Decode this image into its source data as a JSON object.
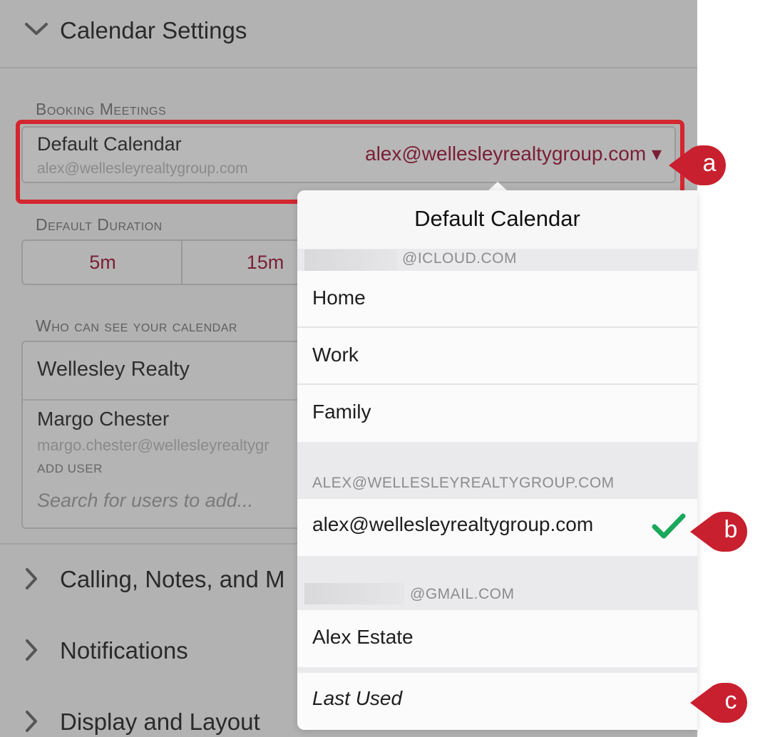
{
  "calendar_settings": {
    "title": "Calendar Settings",
    "booking_header": "Booking Meetings",
    "default_calendar": {
      "label": "Default Calendar",
      "subtitle": "alex@wellesleyrealtygroup.com",
      "value": "alex@wellesleyrealtygroup.com ▾"
    },
    "duration_header": "Default Duration",
    "durations": [
      "5m",
      "15m"
    ],
    "who_header": "Who can see your calendar",
    "who": {
      "group": "Wellesley Realty",
      "user_name": "Margo Chester",
      "user_email": "margo.chester@wellesleyrealtygr",
      "add_user_label": "ADD USER",
      "search_placeholder": "Search for users to add..."
    }
  },
  "sections": [
    {
      "label": "Calling, Notes, and M"
    },
    {
      "label": "Notifications"
    },
    {
      "label": "Display and Layout"
    }
  ],
  "dropdown": {
    "title": "Default Calendar",
    "groups": [
      {
        "label": "@ICLOUD.COM",
        "items": [
          "Home",
          "Work",
          "Family"
        ]
      },
      {
        "label": "ALEX@WELLESLEYREALTYGROUP.COM",
        "items": [
          "alex@wellesleyrealtygroup.com"
        ],
        "selected": "alex@wellesleyrealtygroup.com"
      },
      {
        "label": "@GMAIL.COM",
        "items": [
          "Alex Estate"
        ]
      }
    ],
    "last_used": "Last Used"
  },
  "callouts": [
    "a",
    "b",
    "c"
  ],
  "colors": {
    "accent": "#7a1f36",
    "highlight": "#d3262f",
    "check": "#1aa85a",
    "callout": "#c8202e"
  }
}
